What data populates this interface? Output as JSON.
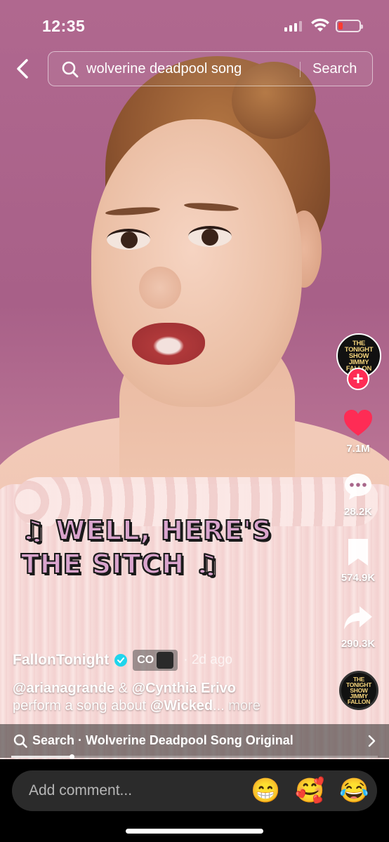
{
  "status_bar": {
    "time": "12:35"
  },
  "search": {
    "query": "wolverine deadpool song",
    "button_label": "Search"
  },
  "lyrics": {
    "line1": "♫ WELL, HERE'S",
    "line2": "THE SITCH ♫"
  },
  "creator": {
    "avatar_text": [
      "THE",
      "TONIGHT",
      "SHOW",
      "JIMMY",
      "FALLON"
    ],
    "name": "FallonTonight",
    "collab_label": "CO",
    "time_ago": "· 2d ago"
  },
  "actions": {
    "follow_label": "+",
    "likes": "7.1M",
    "comments": "28.2K",
    "saves": "574.9K",
    "shares": "290.3K"
  },
  "caption": {
    "mention1": "@arianagrande",
    "amp": " & ",
    "mention2": "@Cynthia Erivo",
    "text": "perform a song about ",
    "mention3": "@Wicked",
    "ellipsis": "...",
    "more": " more"
  },
  "related_search": {
    "label": "Search · Wolverine Deadpool Song Original"
  },
  "playback": {
    "progress": 0.165
  },
  "comment_bar": {
    "placeholder": "Add comment...",
    "emojis": [
      "😁",
      "🥰",
      "😂"
    ]
  },
  "colors": {
    "like": "#fe2c55",
    "verified": "#20d5ec",
    "lyric_fill": "#d9a4cd"
  },
  "icons": [
    "back-arrow-icon",
    "search-icon",
    "heart-icon",
    "comment-icon",
    "bookmark-icon",
    "share-icon",
    "verified-icon",
    "chevron-right-icon"
  ]
}
